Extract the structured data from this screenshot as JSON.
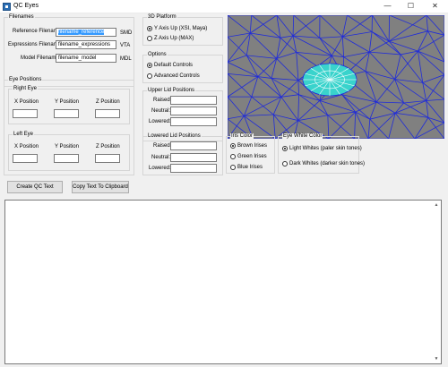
{
  "window": {
    "title": "QC Eyes",
    "minimize": "—",
    "maximize": "☐",
    "close": "✕"
  },
  "filenames": {
    "legend": "Filenames",
    "reference": {
      "label": "Reference Filename:",
      "value": "filename_reference",
      "ext": "SMD"
    },
    "expressions": {
      "label": "Expressions Filename:",
      "value": "filename_expressions",
      "ext": "VTA"
    },
    "model": {
      "label": "Model Filename:",
      "value": "filename_model",
      "ext": "MDL"
    }
  },
  "eye_positions": {
    "legend": "Eye Positions",
    "right_eye": {
      "legend": "Right Eye",
      "x": "X Position",
      "y": "Y Position",
      "z": "Z Position",
      "x_value": "",
      "y_value": "",
      "z_value": ""
    },
    "left_eye": {
      "legend": "Left Eye",
      "x": "X Position",
      "y": "Y Position",
      "z": "Z Position",
      "x_value": "",
      "y_value": "",
      "z_value": ""
    }
  },
  "platform": {
    "legend": "3D Platform",
    "options": [
      {
        "label": "Y Axis Up (XSI, Maya)",
        "selected": true
      },
      {
        "label": "Z Axis Up (MAX)",
        "selected": false
      }
    ]
  },
  "options": {
    "legend": "Options",
    "items": [
      {
        "label": "Default Controls",
        "selected": true
      },
      {
        "label": "Advanced Controls",
        "selected": false
      }
    ]
  },
  "upper_lid": {
    "legend": "Upper Lid Positions",
    "raised": "Raised:",
    "neutral": "Neutral:",
    "lowered": "Lowered:",
    "raised_value": "",
    "neutral_value": "",
    "lowered_value": ""
  },
  "lower_lid": {
    "legend": "Lowered Lid Positions",
    "raised": "Raised:",
    "neutral": "Neutral:",
    "lowered": "Lowered:",
    "raised_value": "",
    "neutral_value": "",
    "lowered_value": ""
  },
  "iris_color": {
    "legend": "Iris Color",
    "options": [
      {
        "label": "Brown Irises",
        "selected": true
      },
      {
        "label": "Green Irises",
        "selected": false
      },
      {
        "label": "Blue Irises",
        "selected": false
      }
    ]
  },
  "eye_white": {
    "legend": "Eye White Color",
    "options": [
      {
        "label": "Light Whites (paler skin tones)",
        "selected": true
      },
      {
        "label": "Dark Whites (darker skin tones)",
        "selected": false
      }
    ]
  },
  "buttons": {
    "create": "Create QC Text",
    "copy": "Copy Text To Clipboard"
  },
  "output": {
    "text": ""
  },
  "colors": {
    "viewport_bg": "#808080",
    "mesh": "#1f2bd9",
    "eye_fill": "#39d3cc",
    "selection": "#3399ff"
  }
}
